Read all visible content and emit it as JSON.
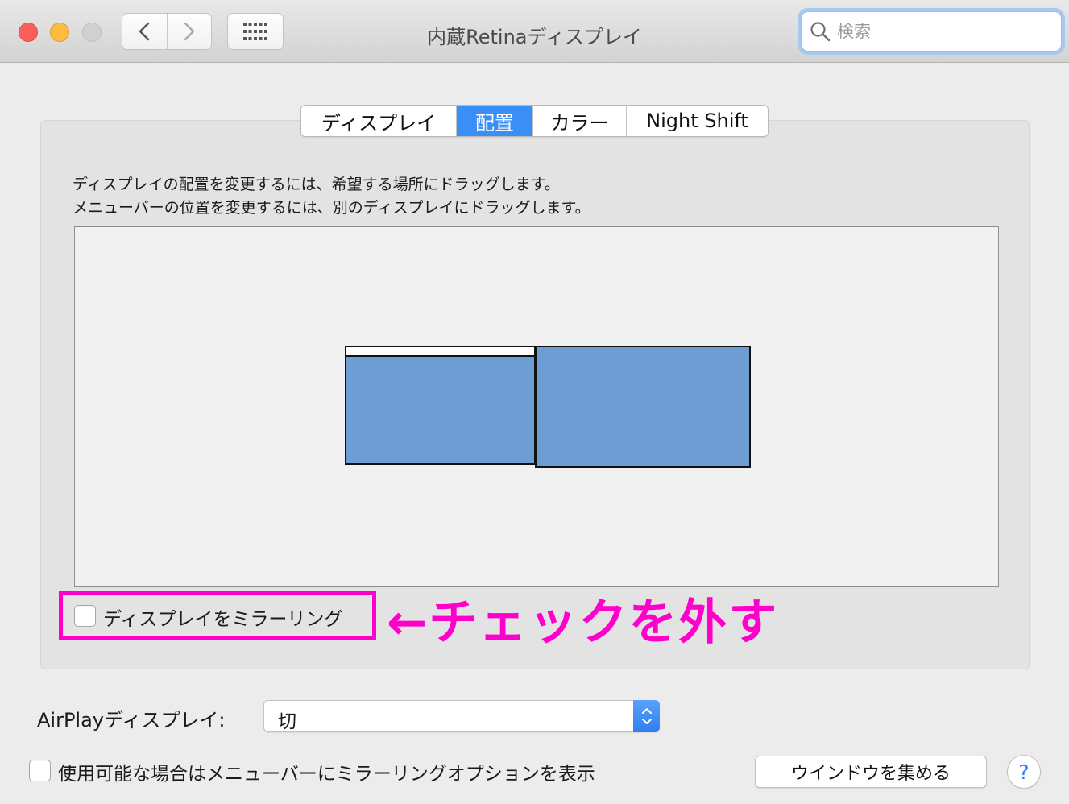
{
  "window": {
    "title": "内蔵Retinaディスプレイ",
    "search": {
      "placeholder": "検索",
      "value": ""
    },
    "icons": {
      "back": "chevron-left-icon",
      "forward": "chevron-right-icon",
      "grid": "grid-icon",
      "search": "magnifier-icon"
    }
  },
  "tabs": [
    {
      "label": "ディスプレイ",
      "active": false
    },
    {
      "label": "配置",
      "active": true
    },
    {
      "label": "カラー",
      "active": false
    },
    {
      "label": "Night Shift",
      "active": false
    }
  ],
  "arrangement": {
    "description_line1": "ディスプレイの配置を変更するには、希望する場所にドラッグします。",
    "description_line2": "メニューバーの位置を変更するには、別のディスプレイにドラッグします。",
    "display_color": "#6d9dd2",
    "mirror": {
      "label": "ディスプレイをミラーリング",
      "checked": false
    },
    "annotation": "←チェックを外す",
    "annotation_color": "#ff00cc"
  },
  "airplay": {
    "label": "AirPlayディスプレイ:",
    "selected": "切"
  },
  "menu_option": {
    "label": "使用可能な場合はメニューバーにミラーリングオプションを表示",
    "checked": false
  },
  "buttons": {
    "gather_windows": "ウインドウを集める",
    "help": "?"
  },
  "colors": {
    "accent": "#3a8ef7",
    "close": "#fc605b",
    "minimize": "#fdbc40",
    "zoom": "#d0d0d0"
  }
}
